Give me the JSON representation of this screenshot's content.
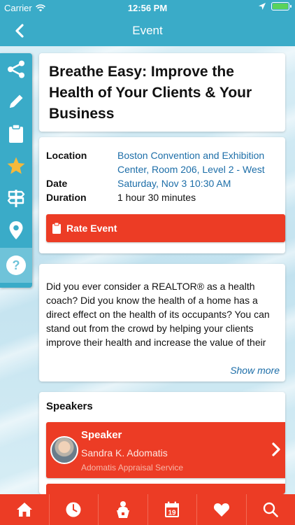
{
  "status_bar": {
    "carrier": "Carrier",
    "time": "12:56 PM",
    "battery_level": 1.0
  },
  "nav": {
    "title": "Event",
    "back_icon": "chevron-left-icon"
  },
  "rail": {
    "items": [
      {
        "icon": "share-icon"
      },
      {
        "icon": "pencil-icon"
      },
      {
        "icon": "clipboard-icon"
      },
      {
        "icon": "star-icon",
        "color": "#f5b93b"
      },
      {
        "icon": "signpost-icon"
      },
      {
        "icon": "location-pin-icon"
      },
      {
        "icon": "help-icon"
      }
    ]
  },
  "event": {
    "title": "Breathe Easy: Improve the Health of Your Clients & Your Business",
    "location_label": "Location",
    "location_value": "Boston Convention and Exhibition Center, Room 206, Level 2 - West",
    "date_label": "Date",
    "date_value": "Saturday, Nov 3 10:30 AM",
    "duration_label": "Duration",
    "duration_value": "1 hour 30 minutes",
    "rate_label": "Rate Event"
  },
  "description": {
    "text": "Did you ever consider a REALTOR® as a health coach? Did you know the health of a home has a direct effect on the health of its occupants? You can stand out from the crowd by helping your clients improve their health and increase the value of their home by improving its indoor air quality. This session",
    "show_more": "Show more"
  },
  "speakers": {
    "heading": "Speakers",
    "items": [
      {
        "role": "Speaker",
        "name": "Sandra K. Adomatis",
        "org": "Adomatis Appraisal Service"
      }
    ]
  },
  "tabbar": {
    "items": [
      {
        "icon": "home-icon"
      },
      {
        "icon": "clock-icon"
      },
      {
        "icon": "person-podium-icon"
      },
      {
        "icon": "calendar-icon",
        "day": "19"
      },
      {
        "icon": "heart-icon"
      },
      {
        "icon": "search-icon"
      }
    ]
  },
  "colors": {
    "brand_blue": "#3aabc8",
    "accent_red": "#ec3c25",
    "link_blue": "#1d6ea8"
  }
}
